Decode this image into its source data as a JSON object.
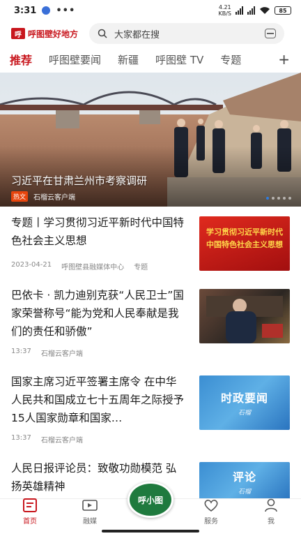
{
  "status": {
    "time": "3:31",
    "net_speed_top": "4.21",
    "net_speed_bottom": "KB/S",
    "battery": "85"
  },
  "header": {
    "logo_mark": "呼",
    "logo_text": "呼图壁好地方",
    "search_placeholder": "大家都在搜"
  },
  "tabs": [
    "推荐",
    "呼图壁要闻",
    "新疆",
    "呼图壁 TV",
    "专题"
  ],
  "tab_add": "+",
  "hero": {
    "title": "习近平在甘肃兰州市考察调研",
    "badge": "热文",
    "source": "石榴云客户端",
    "slide_count": 5,
    "active_slide": 0
  },
  "news": [
    {
      "title": "专题丨学习贯彻习近平新时代中国特色社会主义思想",
      "meta": [
        "2023-04-21",
        "呼图壁县融媒体中心",
        "专题"
      ],
      "thumb_text": "学习贯彻习近平新时代中国特色社会主义思想"
    },
    {
      "title": "巴依卡 · 凯力迪别克获“人民卫士”国家荣誉称号“能为党和人民奉献是我们的责任和骄傲”",
      "meta": [
        "13:37",
        "石榴云客户端"
      ]
    },
    {
      "title": "国家主席习近平签署主席令 在中华人民共和国成立七十五周年之际授予15人国家勋章和国家…",
      "meta": [
        "13:37",
        "石榴云客户端"
      ],
      "thumb_text": "时政要闻",
      "thumb_sub": "石榴"
    },
    {
      "title": "人民日报评论员：致敬功勋模范 弘扬英雄精神",
      "thumb_text": "评论",
      "thumb_sub": "石榴"
    }
  ],
  "nav": {
    "home": "首页",
    "media": "融媒",
    "center": "呼小图",
    "service": "服务",
    "me": "我"
  },
  "colors": {
    "brand_red": "#c8161d",
    "center_green": "#1f7a3e"
  }
}
